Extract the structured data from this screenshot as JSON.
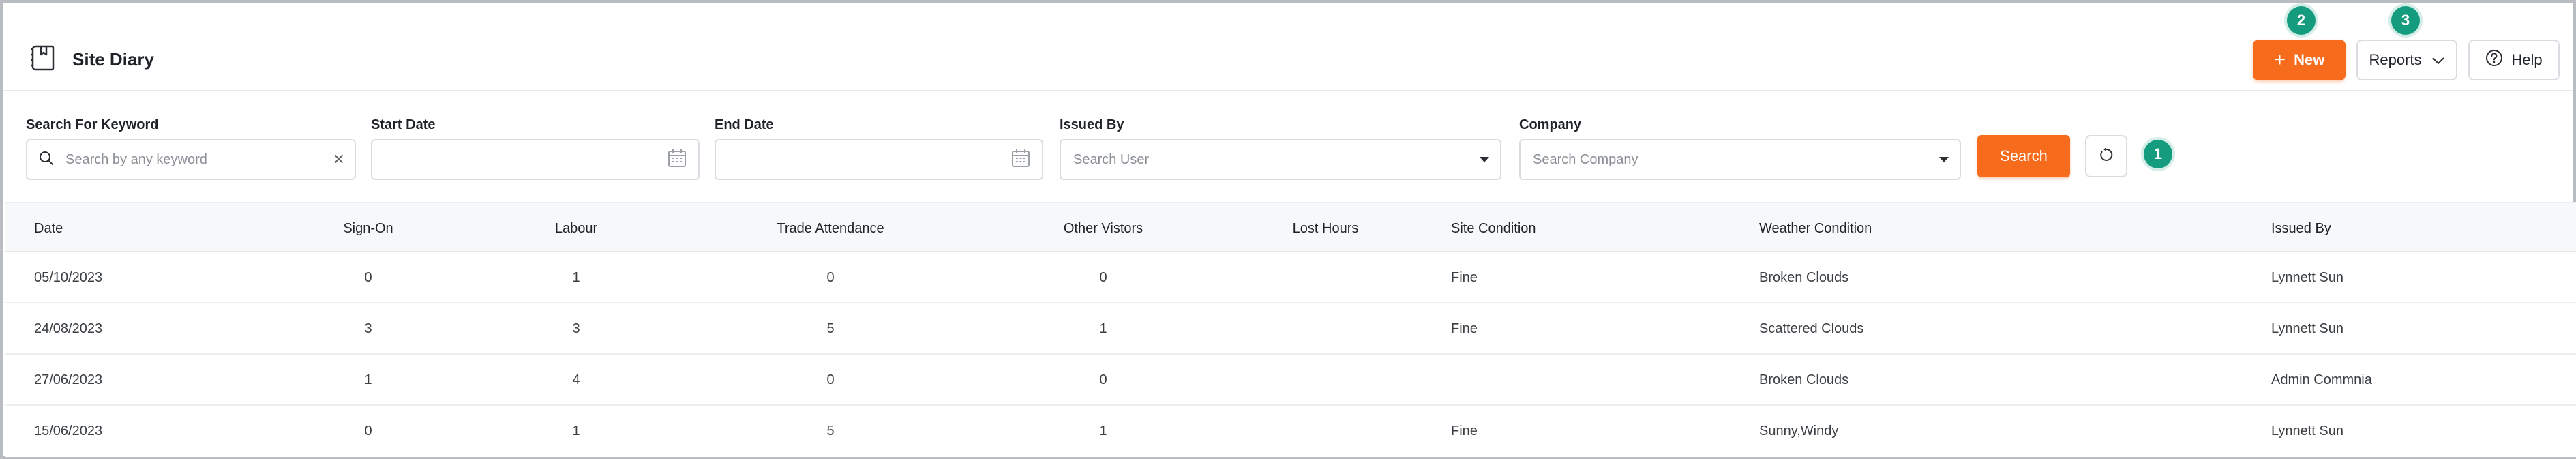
{
  "header": {
    "title": "Site Diary",
    "icon": "diary-book-icon",
    "buttons": {
      "new_label": "New",
      "reports_label": "Reports",
      "help_label": "Help"
    }
  },
  "badges": {
    "reset": "1",
    "new": "2",
    "reports": "3"
  },
  "filters": {
    "keyword": {
      "label": "Search For Keyword",
      "placeholder": "Search by any keyword",
      "value": ""
    },
    "start_date": {
      "label": "Start Date",
      "value": ""
    },
    "end_date": {
      "label": "End Date",
      "value": ""
    },
    "issued_by": {
      "label": "Issued By",
      "placeholder": "Search User"
    },
    "company": {
      "label": "Company",
      "placeholder": "Search Company"
    },
    "search_label": "Search"
  },
  "table": {
    "columns": [
      "Date",
      "Sign-On",
      "Labour",
      "Trade Attendance",
      "Other Vistors",
      "Lost Hours",
      "Site Condition",
      "Weather Condition",
      "Issued By"
    ],
    "rows": [
      [
        "05/10/2023",
        "0",
        "1",
        "0",
        "0",
        "",
        "Fine",
        "Broken Clouds",
        "Lynnett Sun"
      ],
      [
        "24/08/2023",
        "3",
        "3",
        "5",
        "1",
        "",
        "Fine",
        "Scattered Clouds",
        "Lynnett Sun"
      ],
      [
        "27/06/2023",
        "1",
        "4",
        "0",
        "0",
        "",
        "",
        "Broken Clouds",
        "Admin Commnia"
      ],
      [
        "15/06/2023",
        "0",
        "1",
        "5",
        "1",
        "",
        "Fine",
        "Sunny,Windy",
        "Lynnett Sun"
      ]
    ]
  },
  "colors": {
    "accent": "#f76b1c",
    "badge": "#159c7e"
  }
}
